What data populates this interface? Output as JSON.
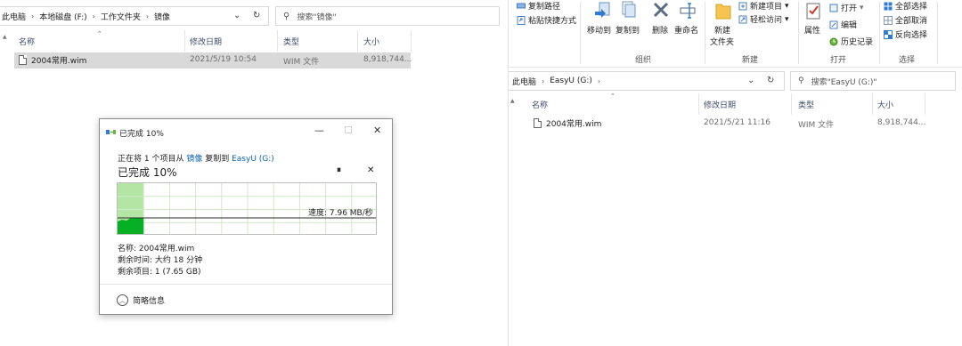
{
  "left_explorer": {
    "breadcrumb": [
      "此电脑",
      "本地磁盘 (F:)",
      "工作文件夹",
      "镜像"
    ],
    "search_placeholder": "搜索\"镜像\"",
    "columns": {
      "name": "名称",
      "modified": "修改日期",
      "type": "类型",
      "size": "大小"
    },
    "files": [
      {
        "name": "2004常用.wim",
        "modified": "2021/5/19 10:54",
        "type": "WIM 文件",
        "size": "8,918,744..."
      }
    ]
  },
  "right_explorer": {
    "ribbon": {
      "clipboard": {
        "copy_path": "复制路径",
        "paste_shortcut": "粘贴快捷方式"
      },
      "organize": {
        "move_to": "移动到",
        "copy_to": "复制到",
        "delete": "删除",
        "rename": "重命名",
        "label": "组织"
      },
      "new": {
        "new_folder_line1": "新建",
        "new_folder_line2": "文件夹",
        "new_item": "新建项目",
        "easy_access": "轻松访问",
        "label": "新建"
      },
      "open": {
        "properties": "属性",
        "open": "打开",
        "edit": "编辑",
        "history": "历史记录",
        "label": "打开"
      },
      "select": {
        "select_all": "全部选择",
        "select_none": "全部取消",
        "invert": "反向选择",
        "label": "选择"
      }
    },
    "breadcrumb": [
      "此电脑",
      "EasyU (G:)"
    ],
    "search_placeholder": "搜索\"EasyU (G:)\"",
    "columns": {
      "name": "名称",
      "modified": "修改日期",
      "type": "类型",
      "size": "大小"
    },
    "files": [
      {
        "name": "2004常用.wim",
        "modified": "2021/5/21 11:16",
        "type": "WIM 文件",
        "size": "8,918,744..."
      }
    ]
  },
  "copy_dialog": {
    "title": "已完成 10%",
    "line_prefix": "正在将 1 个项目从",
    "source": "镜像",
    "line_mid": "复制到",
    "destination": "EasyU (G:)",
    "percent_label": "已完成 10%",
    "progress_fraction": 0.1,
    "speed": "速度: 7.96 MB/秒",
    "name_line": "名称: 2004常用.wim",
    "time_left": "剩余时间: 大约 18 分钟",
    "items_left": "剩余项目: 1 (7.65 GB)",
    "less_details": "简略信息",
    "colors": {
      "progress_fill": "#b3e6a5",
      "speed_fill": "#06b025",
      "speed_line": "#2b2b2b"
    }
  }
}
